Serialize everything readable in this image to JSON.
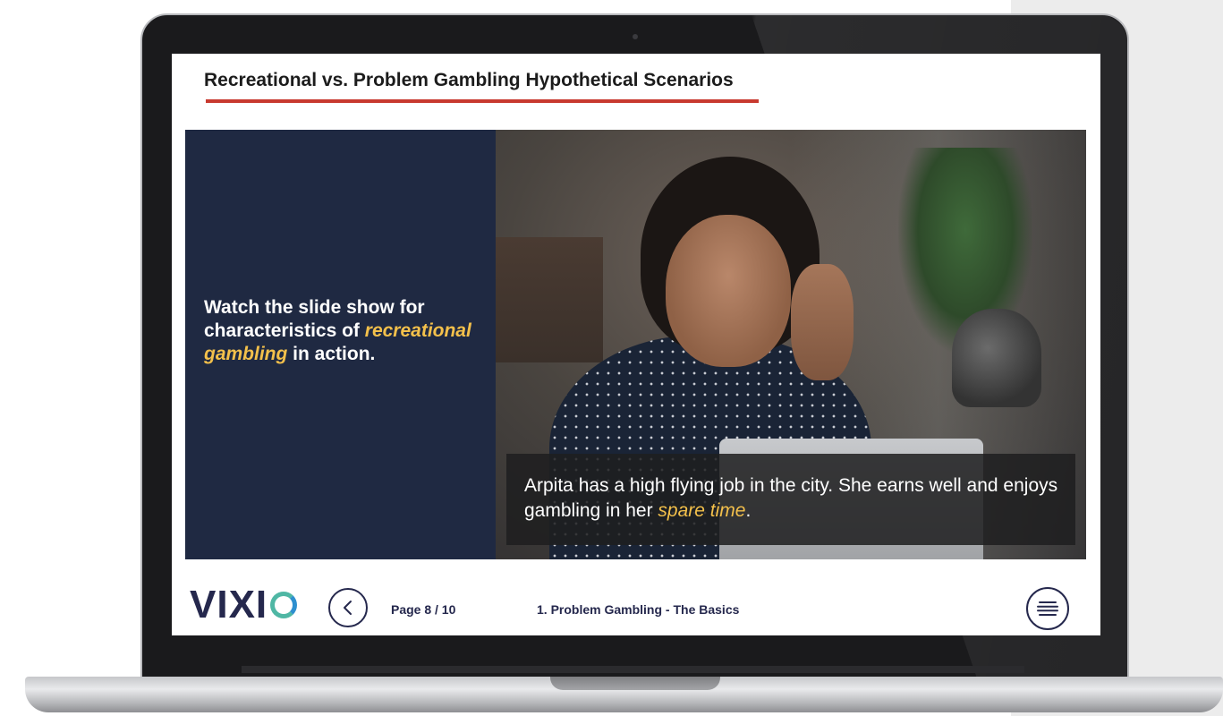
{
  "slide": {
    "title": "Recreational vs. Problem Gambling Hypothetical Scenarios",
    "instruction": {
      "part1": "Watch the slide show for characteristics of ",
      "highlight": "recreational gambling",
      "part2": " in action."
    },
    "caption": {
      "part1": "Arpita has a high flying job in the city. She earns well and enjoys gambling in her ",
      "highlight": "spare time",
      "part2": "."
    }
  },
  "footer": {
    "logo_text": "VIXI",
    "page_indicator": "Page 8 / 10",
    "module_name": "1. Problem Gambling - The Basics"
  },
  "icons": {
    "back": "chevron-left-icon",
    "menu": "menu-lines-icon"
  },
  "colors": {
    "title_underline": "#c8392f",
    "panel_navy": "#1f2942",
    "highlight_yellow": "#f3c04b",
    "brand_navy": "#25284d",
    "logo_teal": "#4fb7a4"
  }
}
